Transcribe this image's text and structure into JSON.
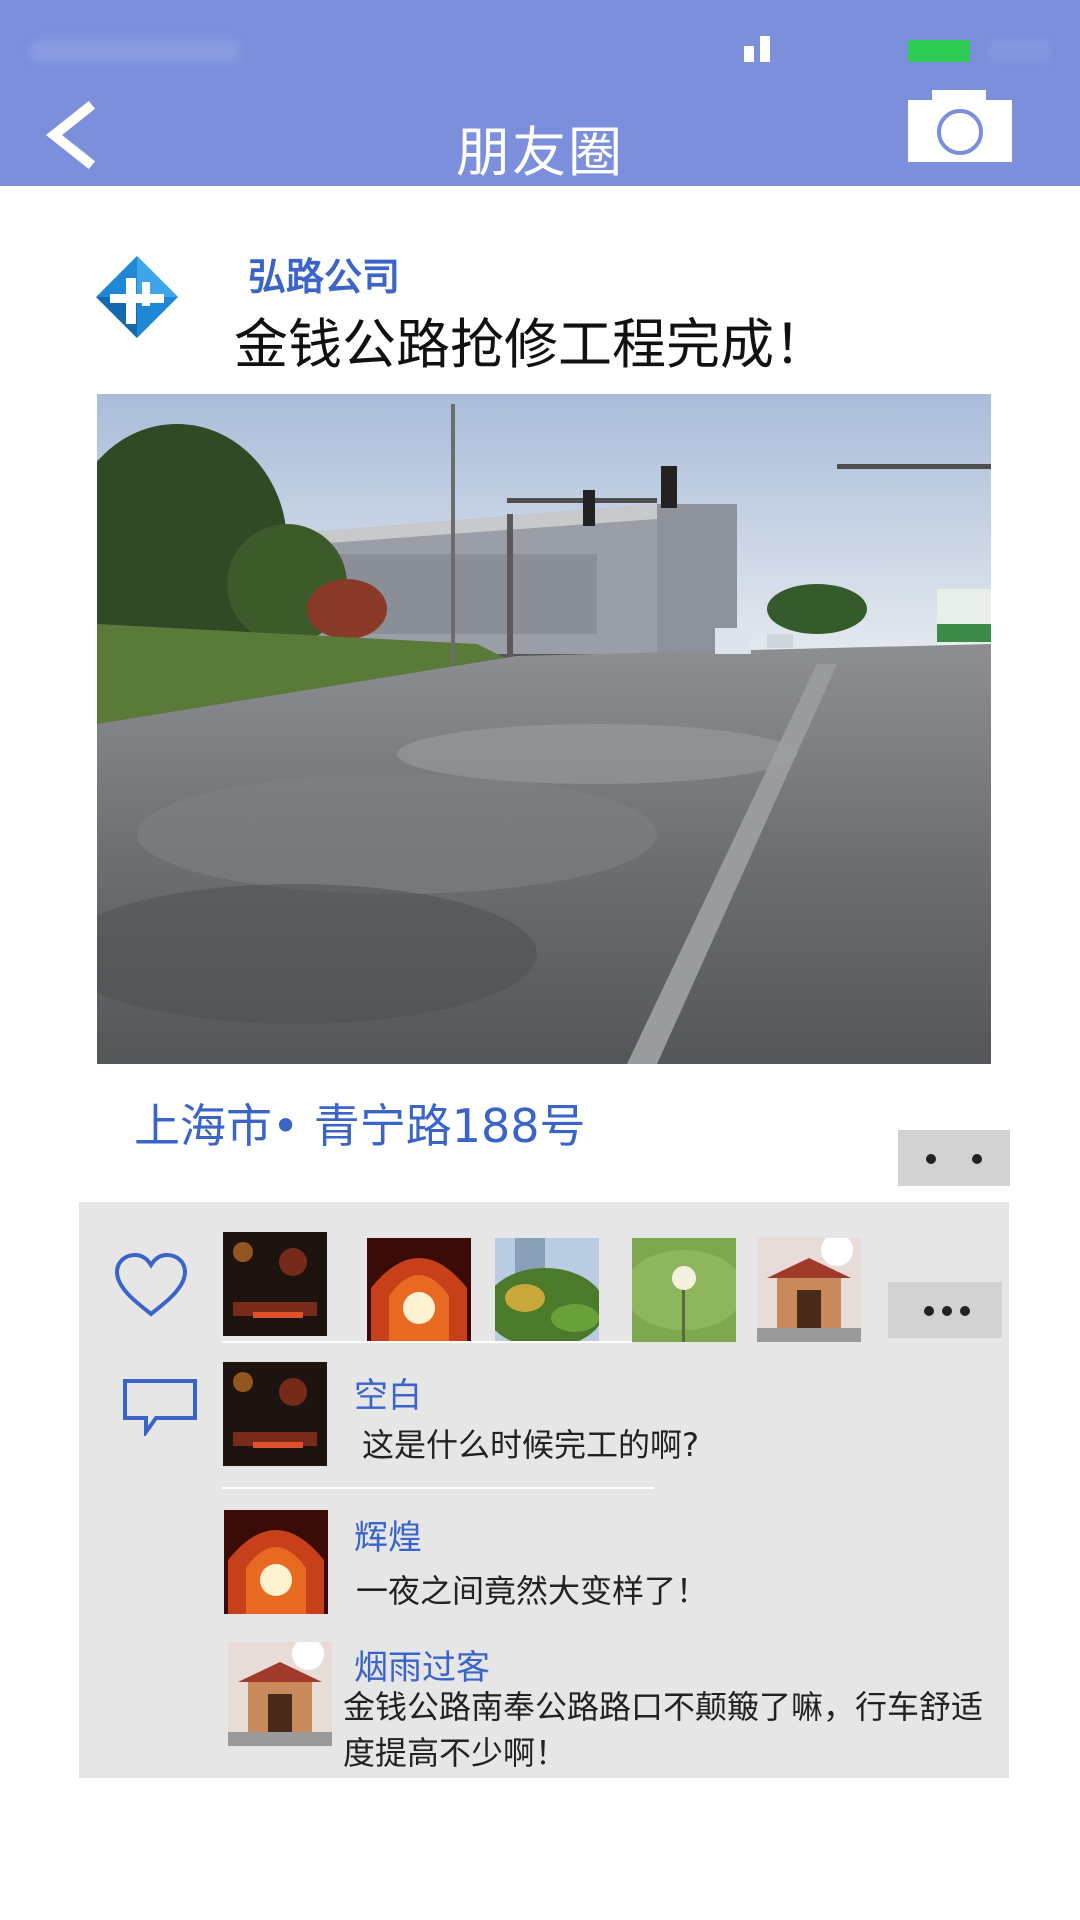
{
  "header": {
    "title": "朋友圈"
  },
  "post": {
    "author": "弘路公司",
    "text": "金钱公路抢修工程完成！",
    "location": "上海市• 青宁路188号"
  },
  "comments": [
    {
      "name": "空白",
      "text": "这是什么时候完工的啊?"
    },
    {
      "name": "辉煌",
      "text": "一夜之间竟然大变样了！"
    },
    {
      "name": "烟雨过客",
      "text": "金钱公路南奉公路路口不颠簸了嘛，行车舒适度提高不少啊！"
    }
  ],
  "colors": {
    "header_bg": "#7b8fdc",
    "accent_text": "#3b64c8",
    "panel_bg": "#e6e6e6",
    "battery": "#2ecc55"
  },
  "icons": [
    "back-arrow-icon",
    "camera-icon",
    "heart-icon",
    "comment-bubble-icon",
    "more-dots-icon",
    "company-logo"
  ]
}
